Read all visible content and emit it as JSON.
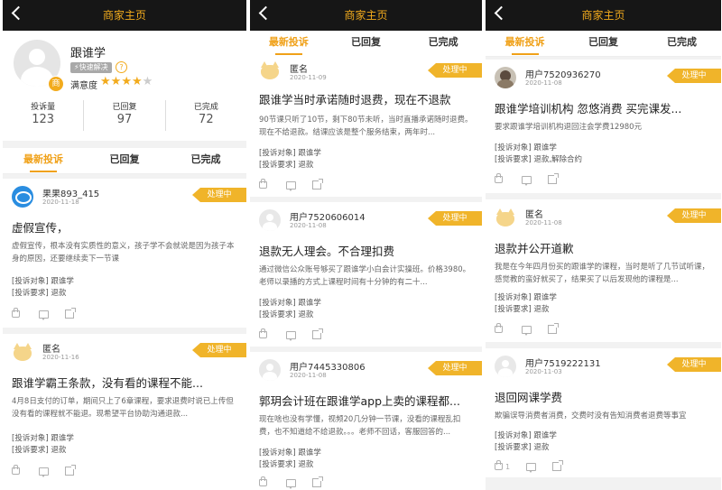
{
  "header": {
    "title": "商家主页"
  },
  "colors": {
    "accent": "#f0a119",
    "badge": "#f0b42a",
    "topbar": "#161616"
  },
  "merchant": {
    "name": "跟谁学",
    "avatar_badge": "商",
    "fast_tag": "快速解决",
    "help_icon": "?",
    "satisfaction_label": "满意度",
    "rating": 4,
    "rating_max": 5,
    "stats": [
      {
        "label": "投诉量",
        "value": "123"
      },
      {
        "label": "已回复",
        "value": "97"
      },
      {
        "label": "已完成",
        "value": "72"
      }
    ]
  },
  "tabs": [
    "最新投诉",
    "已回复",
    "已完成"
  ],
  "labels": {
    "target": "[投诉对象]",
    "request": "[投诉要求]"
  },
  "panels": [
    {
      "cards": [
        {
          "user": "果果893_415",
          "date": "2020-11-18",
          "status": "处理中",
          "title": "虚假宣传，",
          "desc": "虚假宣传，根本没有实质性的意义，孩子学不会就说是因为孩子本身的原因，还要继续卖下一节课",
          "target": "跟谁学",
          "request": "退款",
          "likes": ""
        },
        {
          "user": "匿名",
          "date": "2020-11-16",
          "status": "处理中",
          "title": "跟谁学霸王条款，没有看的课程不能...",
          "desc": "4月8日支付的订单，期间只上了6章课程，要求退费时说已上传但没有看的课程就不能退。现希望平台协助沟通退款...",
          "target": "跟谁学",
          "request": "退款",
          "likes": ""
        }
      ]
    },
    {
      "cards": [
        {
          "user": "匿名",
          "date": "2020-11-09",
          "status": "处理中",
          "title": "跟谁学当时承诺随时退费，现在不退款",
          "desc": "90节课只听了10节，剩下80节未听，当时直播承诺随时退费。现在不给退款。结课应该是整个服务结束，两年时...",
          "target": "跟谁学",
          "request": "退款",
          "likes": ""
        },
        {
          "user": "用户7520606014",
          "date": "2020-11-08",
          "status": "处理中",
          "title": "退款无人理会。不合理扣费",
          "desc": "通过微信公众账号够买了跟谁学小白会计实操班。价格3980。老师以录播的方式上课程时间有十分钟的有二十...",
          "target": "跟谁学",
          "request": "退款",
          "likes": ""
        },
        {
          "user": "用户7445330806",
          "date": "2020-11-08",
          "status": "处理中",
          "title": "郭玥会计班在跟谁学app上卖的课程都...",
          "desc": "现在啥也没有学懂，视频20几分钟一节课，没看的课程乱扣费，也不知道给不给退款。。。老师不回话，客服回答的...",
          "target": "跟谁学",
          "request": "退款",
          "likes": ""
        }
      ]
    },
    {
      "cards": [
        {
          "user": "用户7520936270",
          "date": "2020-11-08",
          "status": "处理中",
          "title": "跟谁学培训机构 忽悠消费  买完课发...",
          "desc": "要求跟谁学培训机构退回注会学费12980元",
          "target": "跟谁学",
          "request": "退款,解除合约",
          "likes": ""
        },
        {
          "user": "匿名",
          "date": "2020-11-08",
          "status": "处理中",
          "title": "退款并公开道歉",
          "desc": "我是在今年四月份买的跟谁学的课程，当时是听了几节试听课，感觉教的蛮好就买了，结果买了以后发现他的课程是...",
          "target": "跟谁学",
          "request": "退款",
          "likes": ""
        },
        {
          "user": "用户7519222131",
          "date": "2020-11-03",
          "status": "处理中",
          "title": "退回网课学费",
          "desc": "欺骗误导消费者消费，交费时没有告知消费者退费等事宜",
          "target": "跟谁学",
          "request": "退款",
          "likes": "1"
        }
      ]
    }
  ]
}
